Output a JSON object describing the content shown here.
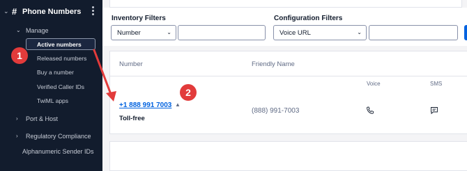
{
  "sidebar": {
    "title": "Phone Numbers",
    "section": "Manage",
    "items": [
      {
        "label": "Active numbers",
        "active": true
      },
      {
        "label": "Released numbers"
      },
      {
        "label": "Buy a number"
      },
      {
        "label": "Verified Caller IDs"
      },
      {
        "label": "TwiML apps"
      }
    ],
    "groups": [
      {
        "label": "Port & Host"
      },
      {
        "label": "Regulatory Compliance"
      }
    ],
    "footer_item": "Alphanumeric Sender IDs",
    "colors": {
      "background": "#121c2d",
      "text": "#c7ccd6"
    }
  },
  "filters": {
    "inventory": {
      "label": "Inventory Filters",
      "selected": "Number",
      "value": ""
    },
    "configuration": {
      "label": "Configuration Filters",
      "selected": "Voice URL",
      "value": ""
    }
  },
  "table": {
    "headers": {
      "number": "Number",
      "friendly_name": "Friendly Name"
    },
    "sub_headers": {
      "voice": "Voice",
      "sms": "SMS"
    },
    "rows": [
      {
        "number": "+1 888 991 7003",
        "type": "Toll-free",
        "friendly_name": "(888) 991-7003",
        "voice_icon": "phone-icon",
        "sms_icon": "message-icon"
      }
    ]
  },
  "annotations": {
    "step1": "1",
    "step2": "2",
    "color": "#e23b3b"
  },
  "colors": {
    "link": "#0263e0",
    "primary_button": "#0263e0"
  }
}
